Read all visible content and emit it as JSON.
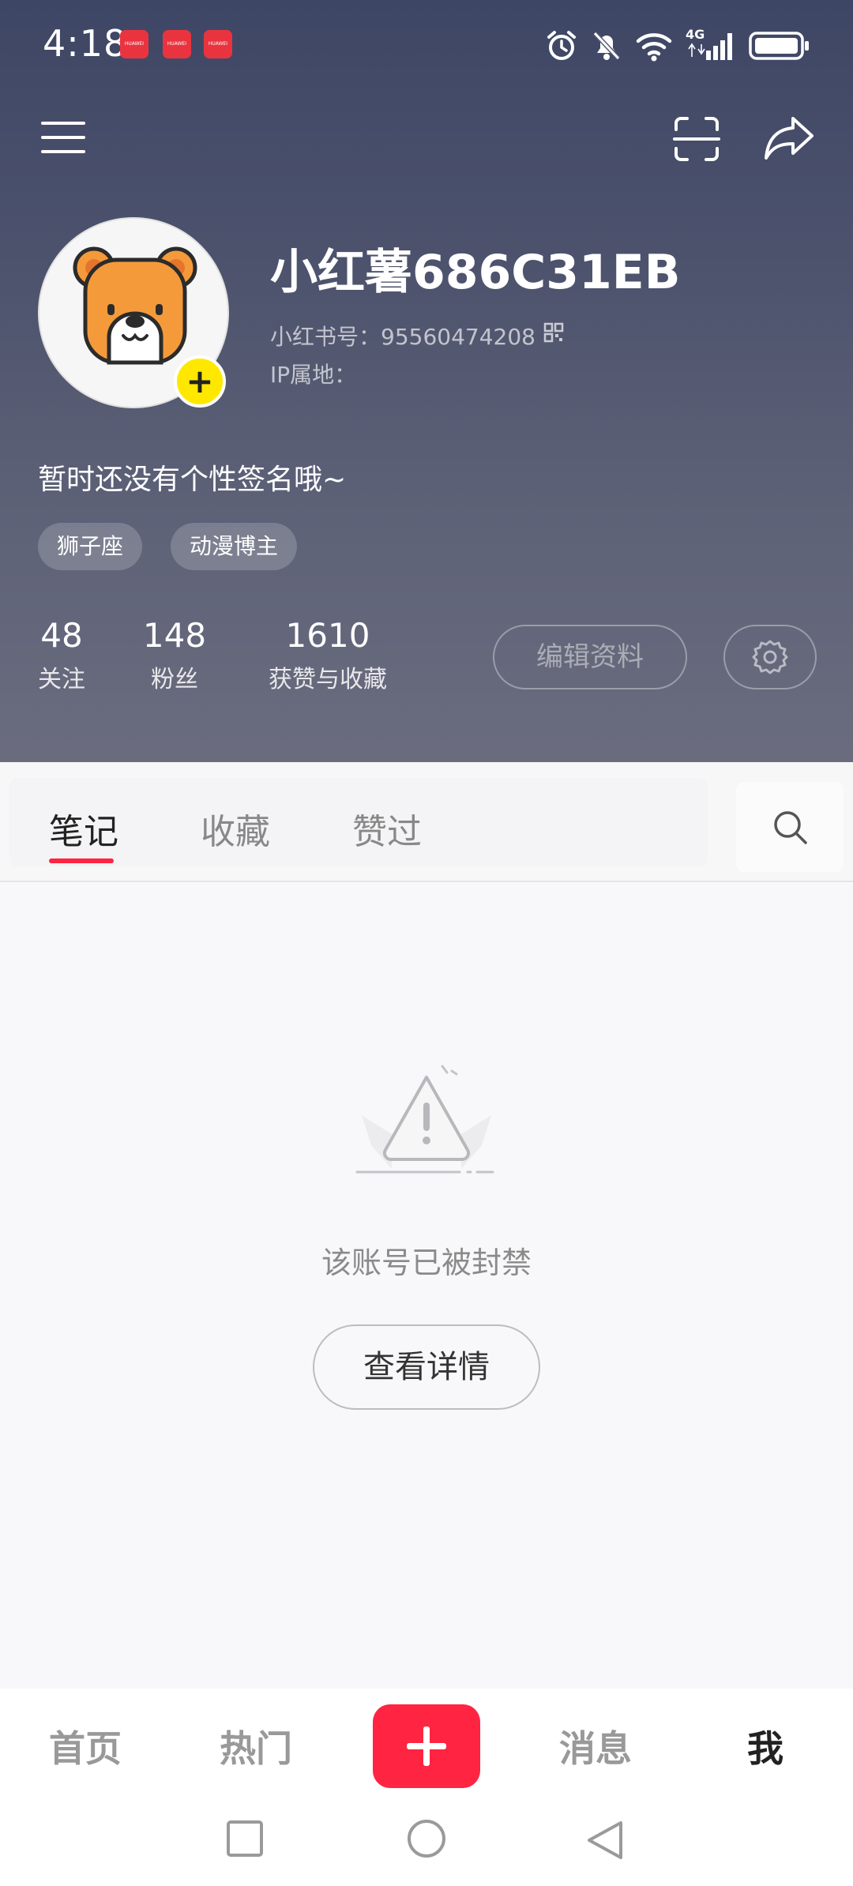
{
  "status_bar": {
    "time": "4:18",
    "notification_badges": [
      "HUAWEI",
      "HUAWEI",
      "HUAWEI"
    ],
    "icons": [
      "alarm-icon",
      "mute-icon",
      "wifi-icon",
      "signal-4g-icon",
      "battery-icon"
    ],
    "network": "4G"
  },
  "profile": {
    "nickname": "小红薯686C31EB",
    "account_id": "小红书号：95560474208",
    "ip_location": "IP属地：",
    "bio": "暂时还没有个性签名哦~",
    "tags": [
      "狮子座",
      "动漫博主"
    ],
    "stats": [
      {
        "value": "48",
        "label": "关注"
      },
      {
        "value": "148",
        "label": "粉丝"
      },
      {
        "value": "1610",
        "label": "获赞与收藏"
      }
    ],
    "edit_button": "编辑资料"
  },
  "tabs": [
    {
      "label": "笔记",
      "active": true
    },
    {
      "label": "收藏",
      "active": false
    },
    {
      "label": "赞过",
      "active": false
    }
  ],
  "empty_state": {
    "message": "该账号已被封禁",
    "button": "查看详情"
  },
  "bottom_nav": [
    {
      "label": "首页",
      "active": false
    },
    {
      "label": "热门",
      "active": false
    },
    {
      "label": "消息",
      "active": false
    },
    {
      "label": "我",
      "active": true
    }
  ],
  "colors": {
    "accent": "#ff2442",
    "header_gradient_top": "#3e4665",
    "header_gradient_bottom": "#6a6c7e",
    "avatar_badge": "#ffe800"
  }
}
